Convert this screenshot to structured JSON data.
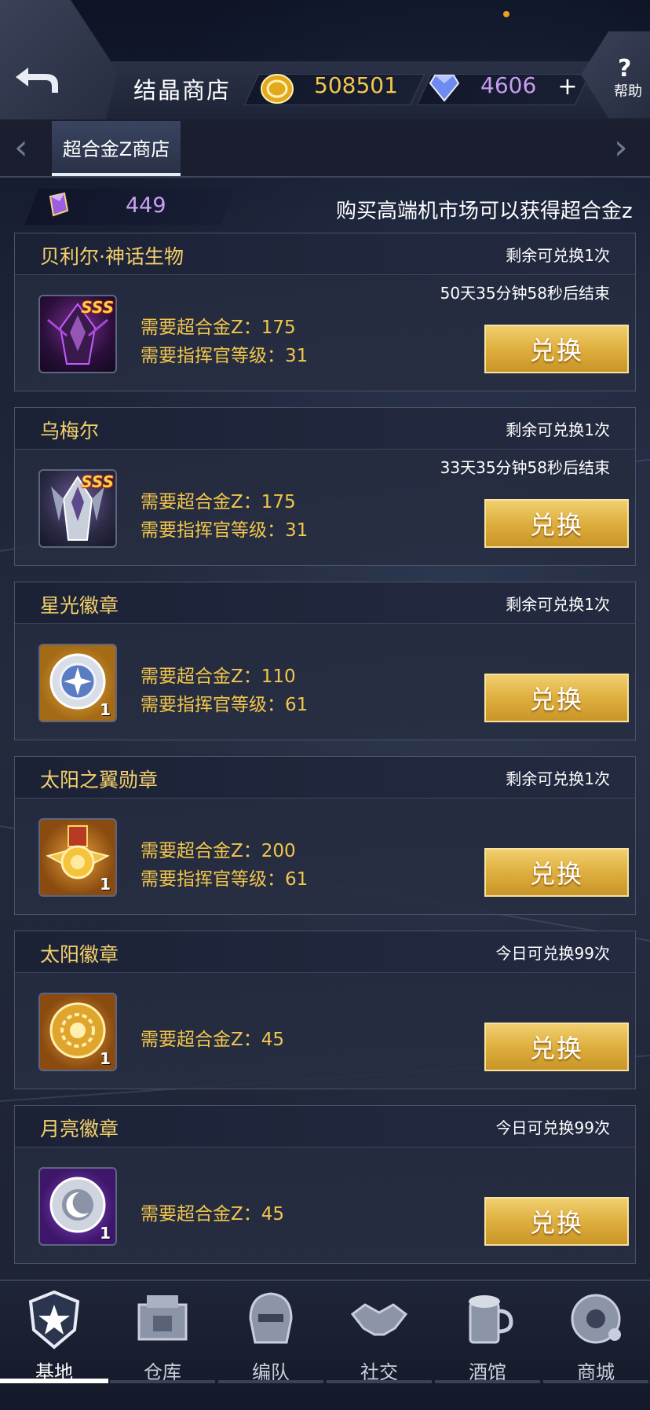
{
  "header": {
    "title": "结晶商店",
    "gold": "508501",
    "gems": "4606",
    "plus_icon": "+",
    "help_icon": "?",
    "help_label": "帮助"
  },
  "tabs": [
    {
      "label": "超合金Z商店",
      "active": true
    }
  ],
  "alloy": {
    "value": "449",
    "hint": "购买高端机市场可以获得超合金z"
  },
  "items": [
    {
      "name": "贝利尔·神话生物",
      "remain": "剩余可兑换1次",
      "timer": "50天35分钟58秒后结束",
      "req1": "需要超合金Z：175",
      "req2": "需要指挥官等级：31",
      "button": "兑换",
      "badge": "SSS",
      "icon": "dark-mecha-icon"
    },
    {
      "name": "乌梅尔",
      "remain": "剩余可兑换1次",
      "timer": "33天35分钟58秒后结束",
      "req1": "需要超合金Z：175",
      "req2": "需要指挥官等级：31",
      "button": "兑换",
      "badge": "SSS",
      "icon": "silver-mecha-icon"
    },
    {
      "name": "星光徽章",
      "remain": "剩余可兑换1次",
      "req1": "需要超合金Z：110",
      "req2": "需要指挥官等级：61",
      "button": "兑换",
      "qty": "1",
      "icon": "starlight-badge-icon"
    },
    {
      "name": "太阳之翼勋章",
      "remain": "剩余可兑换1次",
      "req1": "需要超合金Z：200",
      "req2": "需要指挥官等级：61",
      "button": "兑换",
      "qty": "1",
      "icon": "sun-wing-medal-icon"
    },
    {
      "name": "太阳徽章",
      "remain": "今日可兑换99次",
      "req1": "需要超合金Z：45",
      "button": "兑换",
      "qty": "1",
      "icon": "sun-badge-icon"
    },
    {
      "name": "月亮徽章",
      "remain": "今日可兑换99次",
      "req1": "需要超合金Z：45",
      "button": "兑换",
      "qty": "1",
      "icon": "moon-badge-icon"
    }
  ],
  "nav": [
    {
      "label": "基地",
      "icon": "base-icon",
      "active": true
    },
    {
      "label": "仓库",
      "icon": "warehouse-icon"
    },
    {
      "label": "编队",
      "icon": "formation-icon"
    },
    {
      "label": "社交",
      "icon": "handshake-icon"
    },
    {
      "label": "酒馆",
      "icon": "tavern-icon"
    },
    {
      "label": "商城",
      "icon": "shop-icon"
    }
  ],
  "colors": {
    "gold_text": "#f2c64c",
    "gem_text": "#c89cf0",
    "button": "#deaf3e",
    "item_name": "#f4d06b"
  }
}
